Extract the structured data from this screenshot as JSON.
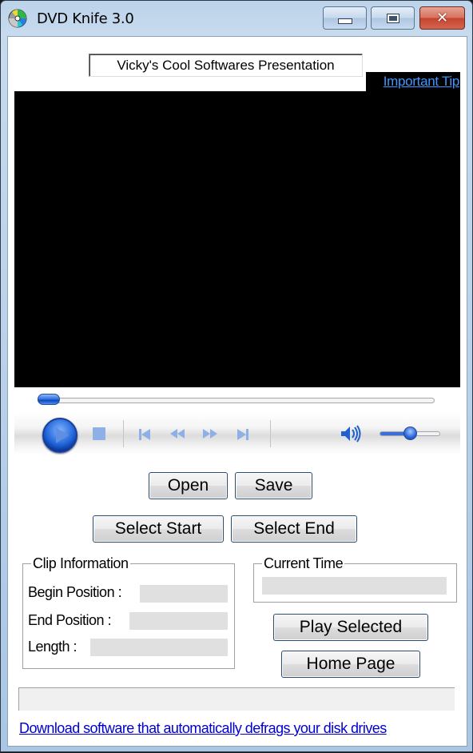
{
  "window": {
    "title": "DVD Knife 3.0",
    "icon": "dvd-disc-icon",
    "controls": {
      "minimize": "minimize-icon",
      "maximize": "maximize-icon",
      "close_glyph": "✕"
    }
  },
  "header": {
    "presentation_text": "Vicky's Cool Softwares Presentation",
    "tip_link": "Important Tip"
  },
  "player": {
    "seek_position": 0.0,
    "volume_level": 0.5,
    "controls": [
      "play",
      "stop",
      "previous",
      "rewind",
      "fast-forward",
      "next",
      "volume"
    ]
  },
  "buttons": {
    "open": "Open",
    "save": "Save",
    "select_start": "Select Start",
    "select_end": "Select End",
    "play_selected": "Play Selected",
    "home_page": "Home Page"
  },
  "clip_info": {
    "legend": "Clip Information",
    "begin_label": "Begin Position :",
    "begin_value": "",
    "end_label": "End Position :",
    "end_value": "",
    "length_label": "Length :",
    "length_value": ""
  },
  "current_time": {
    "legend": "Current Time",
    "value": ""
  },
  "status": {
    "text": ""
  },
  "footer": {
    "ad_link": "Download software that automatically defrags your disk drives"
  },
  "colors": {
    "link_blue": "#3e98ff",
    "ad_link_blue": "#0000d0",
    "video_bg": "#000000",
    "accent_blue": "#2e6ee0"
  }
}
